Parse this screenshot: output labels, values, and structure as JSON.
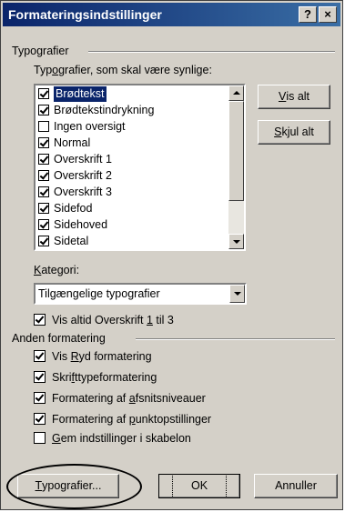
{
  "window": {
    "title": "Formateringsindstillinger",
    "help_btn": "?",
    "close_btn": "×"
  },
  "styles_section": {
    "heading": "Typografier",
    "list_label_pre": "Typ",
    "list_label_u": "o",
    "list_label_post": "grafier, som skal være synlige:",
    "items": [
      {
        "label": "Brødtekst",
        "checked": true,
        "selected": true
      },
      {
        "label": "Brødtekstindrykning",
        "checked": true,
        "selected": false
      },
      {
        "label": "Ingen oversigt",
        "checked": false,
        "selected": false
      },
      {
        "label": "Normal",
        "checked": true,
        "selected": false
      },
      {
        "label": "Overskrift 1",
        "checked": true,
        "selected": false
      },
      {
        "label": "Overskrift 2",
        "checked": true,
        "selected": false
      },
      {
        "label": "Overskrift 3",
        "checked": true,
        "selected": false
      },
      {
        "label": "Sidefod",
        "checked": true,
        "selected": false
      },
      {
        "label": "Sidehoved",
        "checked": true,
        "selected": false
      },
      {
        "label": "Sidetal",
        "checked": true,
        "selected": false
      }
    ],
    "show_all_u": "V",
    "show_all_rest": "is alt",
    "hide_all_u": "S",
    "hide_all_rest": "kjul alt",
    "category_label_u": "K",
    "category_label_rest": "ategori:",
    "category_value": "Tilgængelige typografier",
    "always_show_pre": "Vis altid Overskrift ",
    "always_show_u": "1",
    "always_show_post": " til 3",
    "always_show_checked": true
  },
  "other_section": {
    "heading": "Anden formatering",
    "options": [
      {
        "pre": "Vis ",
        "u": "R",
        "post": "yd formatering",
        "checked": true
      },
      {
        "pre": "Skri",
        "u": "f",
        "post": "ttypeformatering",
        "checked": true
      },
      {
        "pre": "Formatering af ",
        "u": "a",
        "post": "fsnitsniveauer",
        "checked": true
      },
      {
        "pre": "Formatering af ",
        "u": "p",
        "post": "unktopstillinger",
        "checked": true
      }
    ]
  },
  "save_template": {
    "pre": "",
    "u": "G",
    "post": "em indstillinger i skabelon",
    "checked": false
  },
  "footer": {
    "styles_btn_u": "T",
    "styles_btn_rest": "ypografier...",
    "ok_label": "OK",
    "cancel_label": "Annuller"
  }
}
